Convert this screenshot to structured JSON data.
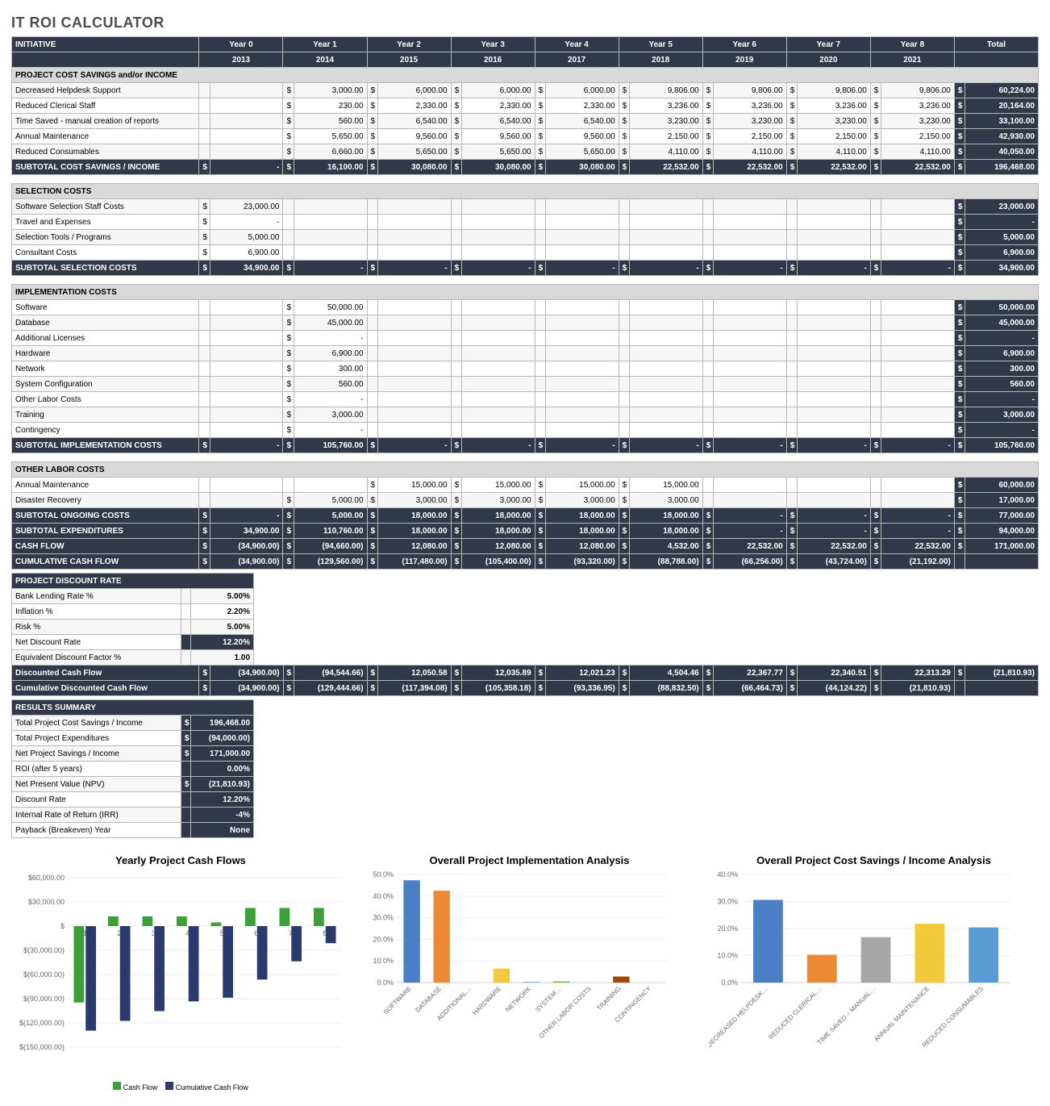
{
  "title": "IT ROI CALCULATOR",
  "columns_header": [
    "INITIATIVE",
    "Year 0",
    "Year 1",
    "Year 2",
    "Year 3",
    "Year 4",
    "Year 5",
    "Year 6",
    "Year 7",
    "Year 8",
    "Total"
  ],
  "years_row": [
    "",
    "2013",
    "2014",
    "2015",
    "2016",
    "2017",
    "2018",
    "2019",
    "2020",
    "2021",
    ""
  ],
  "sections": {
    "savings": {
      "header": "PROJECT COST SAVINGS and/or INCOME",
      "rows": [
        {
          "label": "Decreased Helpdesk Support",
          "vals": [
            "",
            "3,000.00",
            "6,000.00",
            "6,000.00",
            "6,000.00",
            "9,806.00",
            "9,806.00",
            "9,806.00",
            "9,806.00",
            "60,224.00"
          ]
        },
        {
          "label": "Reduced Clerical Staff",
          "vals": [
            "",
            "230.00",
            "2,330.00",
            "2,330.00",
            "2,330.00",
            "3,236.00",
            "3,236.00",
            "3,236.00",
            "3,236.00",
            "20,164.00"
          ]
        },
        {
          "label": "Time Saved - manual creation of reports",
          "vals": [
            "",
            "560.00",
            "6,540.00",
            "6,540.00",
            "6,540.00",
            "3,230.00",
            "3,230.00",
            "3,230.00",
            "3,230.00",
            "33,100.00"
          ]
        },
        {
          "label": "Annual Maintenance",
          "vals": [
            "",
            "5,650.00",
            "9,560.00",
            "9,560.00",
            "9,560.00",
            "2,150.00",
            "2,150.00",
            "2,150.00",
            "2,150.00",
            "42,930.00"
          ]
        },
        {
          "label": "Reduced Consumables",
          "vals": [
            "",
            "6,660.00",
            "5,650.00",
            "5,650.00",
            "5,650.00",
            "4,110.00",
            "4,110.00",
            "4,110.00",
            "4,110.00",
            "40,050.00"
          ]
        }
      ],
      "subtotal": {
        "label": "SUBTOTAL COST SAVINGS / INCOME",
        "vals": [
          "-",
          "16,100.00",
          "30,080.00",
          "30,080.00",
          "30,080.00",
          "22,532.00",
          "22,532.00",
          "22,532.00",
          "22,532.00",
          "196,468.00"
        ]
      }
    },
    "selection": {
      "header": "SELECTION COSTS",
      "rows": [
        {
          "label": "Software Selection Staff Costs",
          "vals": [
            "23,000.00",
            "",
            "",
            "",
            "",
            "",
            "",
            "",
            "",
            "23,000.00"
          ]
        },
        {
          "label": "Travel and Expenses",
          "vals": [
            "-",
            "",
            "",
            "",
            "",
            "",
            "",
            "",
            "",
            "-"
          ]
        },
        {
          "label": "Selection Tools / Programs",
          "vals": [
            "5,000.00",
            "",
            "",
            "",
            "",
            "",
            "",
            "",
            "",
            "5,000.00"
          ]
        },
        {
          "label": "Consultant Costs",
          "vals": [
            "6,900.00",
            "",
            "",
            "",
            "",
            "",
            "",
            "",
            "",
            "6,900.00"
          ]
        }
      ],
      "subtotal": {
        "label": "SUBTOTAL SELECTION COSTS",
        "vals": [
          "34,900.00",
          "-",
          "-",
          "-",
          "-",
          "-",
          "-",
          "-",
          "-",
          "34,900.00"
        ]
      }
    },
    "implementation": {
      "header": "IMPLEMENTATION COSTS",
      "rows": [
        {
          "label": "Software",
          "vals": [
            "",
            "50,000.00",
            "",
            "",
            "",
            "",
            "",
            "",
            "",
            "50,000.00"
          ]
        },
        {
          "label": "Database",
          "vals": [
            "",
            "45,000.00",
            "",
            "",
            "",
            "",
            "",
            "",
            "",
            "45,000.00"
          ]
        },
        {
          "label": "Additional Licenses",
          "vals": [
            "",
            "-",
            "",
            "",
            "",
            "",
            "",
            "",
            "",
            "-"
          ]
        },
        {
          "label": "Hardware",
          "vals": [
            "",
            "6,900.00",
            "",
            "",
            "",
            "",
            "",
            "",
            "",
            "6,900.00"
          ]
        },
        {
          "label": "Network",
          "vals": [
            "",
            "300.00",
            "",
            "",
            "",
            "",
            "",
            "",
            "",
            "300.00"
          ]
        },
        {
          "label": "System Configuration",
          "vals": [
            "",
            "560.00",
            "",
            "",
            "",
            "",
            "",
            "",
            "",
            "560.00"
          ]
        },
        {
          "label": "Other Labor Costs",
          "vals": [
            "",
            "-",
            "",
            "",
            "",
            "",
            "",
            "",
            "",
            "-"
          ]
        },
        {
          "label": "Training",
          "vals": [
            "",
            "3,000.00",
            "",
            "",
            "",
            "",
            "",
            "",
            "",
            "3,000.00"
          ]
        },
        {
          "label": "Contingency",
          "vals": [
            "",
            "-",
            "",
            "",
            "",
            "",
            "",
            "",
            "",
            "-"
          ]
        }
      ],
      "subtotal": {
        "label": "SUBTOTAL IMPLEMENTATION COSTS",
        "vals": [
          "-",
          "105,760.00",
          "-",
          "-",
          "-",
          "-",
          "-",
          "-",
          "-",
          "105,760.00"
        ]
      }
    },
    "other": {
      "header": "OTHER LABOR COSTS",
      "rows": [
        {
          "label": "Annual Maintenance",
          "vals": [
            "",
            "",
            "15,000.00",
            "15,000.00",
            "15,000.00",
            "15,000.00",
            "",
            "",
            "",
            "60,000.00"
          ]
        },
        {
          "label": "Disaster Recovery",
          "vals": [
            "",
            "5,000.00",
            "3,000.00",
            "3,000.00",
            "3,000.00",
            "3,000.00",
            "",
            "",
            "",
            "17,000.00"
          ]
        }
      ],
      "subtotals": [
        {
          "label": "SUBTOTAL ONGOING COSTS",
          "vals": [
            "-",
            "5,000.00",
            "18,000.00",
            "18,000.00",
            "18,000.00",
            "18,000.00",
            "-",
            "-",
            "-",
            "77,000.00"
          ]
        },
        {
          "label": "SUBTOTAL EXPENDITURES",
          "vals": [
            "34,900.00",
            "110,760.00",
            "18,000.00",
            "18,000.00",
            "18,000.00",
            "18,000.00",
            "-",
            "-",
            "-",
            "94,000.00"
          ]
        },
        {
          "label": "CASH FLOW",
          "vals": [
            "(34,900.00)",
            "(94,660.00)",
            "12,080.00",
            "12,080.00",
            "12,080.00",
            "4,532.00",
            "22,532.00",
            "22,532.00",
            "22,532.00",
            "171,000.00"
          ]
        },
        {
          "label": "CUMULATIVE CASH FLOW",
          "vals": [
            "(34,900.00)",
            "(129,560.00)",
            "(117,480.00)",
            "(105,400.00)",
            "(93,320.00)",
            "(88,788.00)",
            "(66,256.00)",
            "(43,724.00)",
            "(21,192.00)",
            ""
          ]
        }
      ]
    }
  },
  "discount_rate": {
    "header": "PROJECT DISCOUNT RATE",
    "rows": [
      {
        "label": "Bank Lending Rate %",
        "val": "5.00%"
      },
      {
        "label": "Inflation %",
        "val": "2.20%"
      },
      {
        "label": "Risk %",
        "val": "5.00%"
      },
      {
        "label": "Net Discount Rate",
        "val": "12.20%",
        "dark": true
      },
      {
        "label": "Equivalent Discount Factor %",
        "val": "1.00"
      }
    ],
    "dcf": {
      "label": "Discounted Cash Flow",
      "vals": [
        "(34,900.00)",
        "(94,544.66)",
        "12,050.58",
        "12,035.89",
        "12,021.23",
        "4,504.46",
        "22,367.77",
        "22,340.51",
        "22,313.29",
        "(21,810.93)"
      ]
    },
    "cdcf": {
      "label": "Cumulative Discounted Cash Flow",
      "vals": [
        "(34,900.00)",
        "(129,444.66)",
        "(117,394.08)",
        "(105,358.18)",
        "(93,336.95)",
        "(88,832.50)",
        "(66,464.73)",
        "(44,124.22)",
        "(21,810.93)",
        ""
      ]
    }
  },
  "results": {
    "header": "RESULTS SUMMARY",
    "rows": [
      {
        "label": "Total Project Cost Savings / Income",
        "val": "196,468.00",
        "cur": true,
        "dark": true
      },
      {
        "label": "Total Project Expenditures",
        "val": "(94,000.00)",
        "cur": true,
        "dark": true
      },
      {
        "label": "Net Project Savings / Income",
        "val": "171,000.00",
        "cur": true,
        "dark": true
      },
      {
        "label": "ROI (after 5 years)",
        "val": "0.00%",
        "dark": true
      },
      {
        "label": "Net Present Value (NPV)",
        "val": "(21,810.93)",
        "cur": true,
        "dark": true
      },
      {
        "label": "Discount Rate",
        "val": "12.20%",
        "dark": true
      },
      {
        "label": "Internal Rate of Return (IRR)",
        "val": "-4%",
        "dark": true
      },
      {
        "label": "Payback (Breakeven) Year",
        "val": "None",
        "dark": true
      }
    ]
  },
  "chart_data": [
    {
      "type": "bar",
      "title": "Yearly Project Cash Flows",
      "categories": [
        "1",
        "2",
        "3",
        "4",
        "5",
        "6",
        "7",
        "8"
      ],
      "series": [
        {
          "name": "Cash Flow",
          "color": "#3aa037",
          "values": [
            -94660,
            12080,
            12080,
            12080,
            4532,
            22532,
            22532,
            22532
          ]
        },
        {
          "name": "Cumulative Cash Flow",
          "color": "#2a3a6e",
          "values": [
            -129560,
            -117480,
            -105400,
            -93320,
            -88788,
            -66256,
            -43724,
            -21192
          ]
        }
      ],
      "ylim": [
        -150000,
        60000
      ],
      "yticks": [
        "$60,000.00",
        "$30,000.00",
        "$",
        "$(30,000.00)",
        "$(60,000.00)",
        "$(90,000.00)",
        "$(120,000.00)",
        "$(150,000.00)"
      ]
    },
    {
      "type": "bar",
      "title": "Overall Project Implementation Analysis",
      "categories": [
        "SOFTWARE",
        "DATABASE",
        "ADDITIONAL…",
        "HARDWARE",
        "NETWORK",
        "SYSTEM…",
        "OTHER LABOR COSTS",
        "TRAINING",
        "CONTINGENCY"
      ],
      "values": [
        47.3,
        42.5,
        0,
        6.5,
        0.3,
        0.5,
        0,
        2.8,
        0
      ],
      "colors": [
        "#4a7fc5",
        "#ec8a33",
        "#a6a6a6",
        "#f3c93c",
        "#5b9bd5",
        "#70ad47",
        "#264478",
        "#9e480e",
        "#636363"
      ],
      "ylim": [
        0,
        50
      ],
      "yticks": [
        "50.0%",
        "40.0%",
        "30.0%",
        "20.0%",
        "10.0%",
        "0.0%"
      ]
    },
    {
      "type": "bar",
      "title": "Overall Project Cost Savings / Income Analysis",
      "categories": [
        "DECREASED HELPDESK…",
        "REDUCED CLERICAL…",
        "TIME SAVED – MANUAL…",
        "ANNUAL MAINTENANCE",
        "REDUCED CONSUMABLES"
      ],
      "values": [
        30.6,
        10.3,
        16.8,
        21.8,
        20.4
      ],
      "colors": [
        "#4a7fc5",
        "#ec8a33",
        "#a6a6a6",
        "#f3c93c",
        "#5b9bd5"
      ],
      "ylim": [
        0,
        40
      ],
      "yticks": [
        "40.0%",
        "30.0%",
        "20.0%",
        "10.0%",
        "0.0%"
      ]
    }
  ]
}
